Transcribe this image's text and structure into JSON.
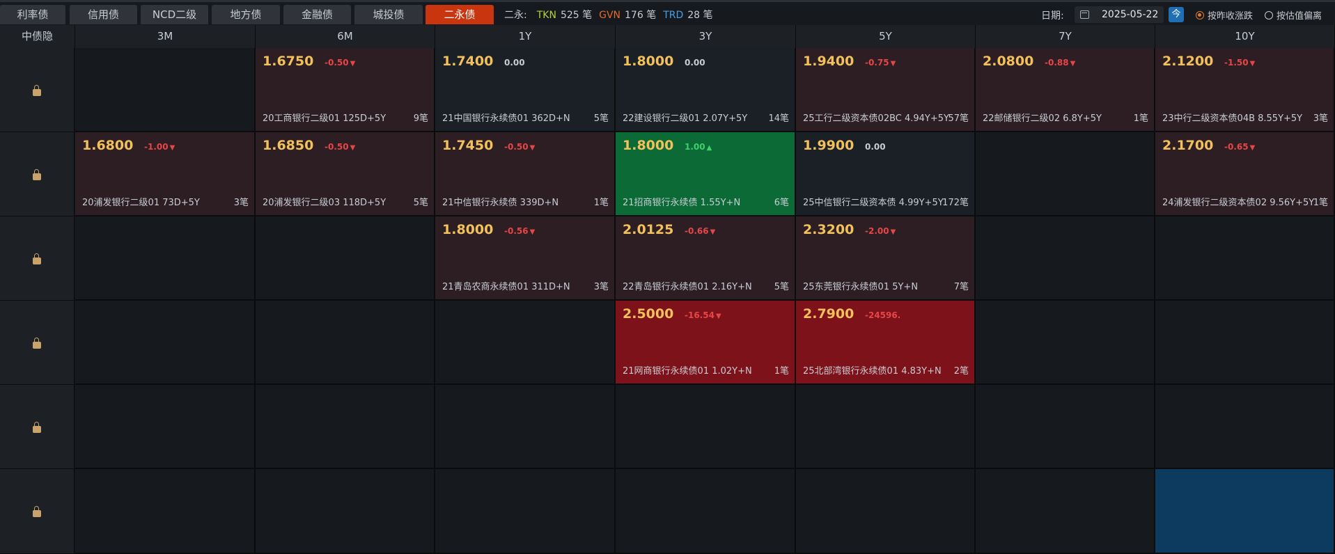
{
  "tabs": [
    {
      "label": "利率债",
      "active": false
    },
    {
      "label": "信用债",
      "active": false
    },
    {
      "label": "NCD二级",
      "active": false
    },
    {
      "label": "地方债",
      "active": false
    },
    {
      "label": "金融债",
      "active": false
    },
    {
      "label": "城投债",
      "active": false
    },
    {
      "label": "二永债",
      "active": true
    }
  ],
  "summary": {
    "prefix": "二永:",
    "tkn_label": "TKN",
    "tkn_value": "525 笔",
    "gvn_label": "GVN",
    "gvn_value": "176 笔",
    "trd_label": "TRD",
    "trd_value": "28 笔"
  },
  "date": {
    "label": "日期:",
    "value": "2025-05-22",
    "today_label": "今"
  },
  "radios": [
    {
      "label": "按昨收涨跌",
      "checked": true
    },
    {
      "label": "按估值偏离",
      "checked": false
    }
  ],
  "grid": {
    "corner_label": "中债隐",
    "columns": [
      "3M",
      "6M",
      "1Y",
      "3Y",
      "5Y",
      "7Y",
      "10Y"
    ],
    "rows": [
      [
        null,
        {
          "price": "1.6750",
          "chg": "-0.50",
          "dir": "down",
          "name": "20工商银行二级01 125D+5Y",
          "count": "9笔",
          "color": "dark-red"
        },
        {
          "price": "1.7400",
          "chg": "0.00",
          "dir": "flat",
          "name": "21中国银行永续债01 362D+N",
          "count": "5笔",
          "color": "slate"
        },
        {
          "price": "1.8000",
          "chg": "0.00",
          "dir": "flat",
          "name": "22建设银行二级01 2.07Y+5Y",
          "count": "14笔",
          "color": "slate"
        },
        {
          "price": "1.9400",
          "chg": "-0.75",
          "dir": "down",
          "name": "25工行二级资本债02BC 4.94Y+5Y",
          "count": "57笔",
          "color": "dark-red"
        },
        {
          "price": "2.0800",
          "chg": "-0.88",
          "dir": "down",
          "name": "22邮储银行二级02 6.8Y+5Y",
          "count": "1笔",
          "color": "dark-red"
        },
        {
          "price": "2.1200",
          "chg": "-1.50",
          "dir": "down",
          "name": "23中行二级资本债04B 8.55Y+5Y",
          "count": "3笔",
          "color": "dark-red"
        }
      ],
      [
        {
          "price": "1.6800",
          "chg": "-1.00",
          "dir": "down",
          "name": "20浦发银行二级01 73D+5Y",
          "count": "3笔",
          "color": "dark-red"
        },
        {
          "price": "1.6850",
          "chg": "-0.50",
          "dir": "down",
          "name": "20浦发银行二级03 118D+5Y",
          "count": "5笔",
          "color": "dark-red"
        },
        {
          "price": "1.7450",
          "chg": "-0.50",
          "dir": "down",
          "name": "21中信银行永续债 339D+N",
          "count": "1笔",
          "color": "dark-red"
        },
        {
          "price": "1.8000",
          "chg": "1.00",
          "dir": "up",
          "name": "21招商银行永续债 1.55Y+N",
          "count": "6笔",
          "color": "green"
        },
        {
          "price": "1.9900",
          "chg": "0.00",
          "dir": "flat",
          "name": "25中信银行二级资本债 4.99Y+5Y",
          "count": "172笔",
          "color": "slate"
        },
        null,
        {
          "price": "2.1700",
          "chg": "-0.65",
          "dir": "down",
          "name": "24浦发银行二级资本债02 9.56Y+5Y",
          "count": "1笔",
          "color": "dark-red"
        }
      ],
      [
        null,
        null,
        {
          "price": "1.8000",
          "chg": "-0.56",
          "dir": "down",
          "name": "21青岛农商永续债01 311D+N",
          "count": "3笔",
          "color": "dark-red"
        },
        {
          "price": "2.0125",
          "chg": "-0.66",
          "dir": "down",
          "name": "22青岛银行永续债01 2.16Y+N",
          "count": "5笔",
          "color": "dark-red"
        },
        {
          "price": "2.3200",
          "chg": "-2.00",
          "dir": "down",
          "name": "25东莞银行永续债01 5Y+N",
          "count": "7笔",
          "color": "dark-red"
        },
        null,
        null
      ],
      [
        null,
        null,
        null,
        {
          "price": "2.5000",
          "chg": "-16.54",
          "dir": "down",
          "name": "21网商银行永续债01 1.02Y+N",
          "count": "1笔",
          "color": "red"
        },
        {
          "price": "2.7900",
          "chg": "-24596.0",
          "dir": "none",
          "name": "25北部湾银行永续债01 4.83Y+N",
          "count": "2笔",
          "color": "red"
        },
        null,
        null
      ],
      [
        null,
        null,
        null,
        null,
        null,
        null,
        null
      ],
      [
        null,
        null,
        null,
        null,
        null,
        null,
        {
          "price": "",
          "chg": "",
          "dir": "none",
          "name": "",
          "count": "",
          "color": "blue"
        }
      ]
    ]
  },
  "colors": {
    "active_tab": "#c8350f",
    "price": "#f2c15b",
    "down": "#e64646",
    "up": "#3cd16b",
    "dark_red_cell": "#2d1e24",
    "green_cell": "#0c6a37",
    "red_cell": "#7d121b",
    "blue_cell": "#0d3a5f"
  }
}
